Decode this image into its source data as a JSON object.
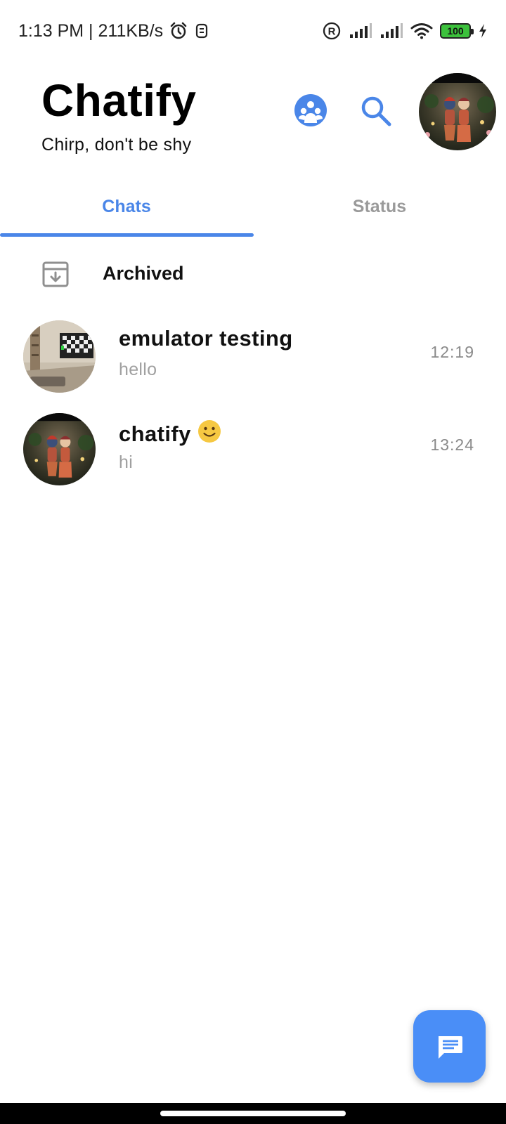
{
  "status_bar": {
    "time_speed": "1:13 PM | 211KB/s",
    "battery": "100",
    "icons": [
      "alarm-icon",
      "notification-icon",
      "registered-icon",
      "signal-icon",
      "signal-icon",
      "wifi-icon",
      "battery-icon",
      "charging-icon"
    ]
  },
  "header": {
    "title": "Chatify",
    "subtitle": "Chirp, don't be shy",
    "icons": [
      "groups-icon",
      "search-icon",
      "profile-avatar"
    ]
  },
  "tabs": [
    {
      "label": "Chats",
      "active": true
    },
    {
      "label": "Status",
      "active": false
    }
  ],
  "archived": {
    "label": "Archived",
    "icon": "archive-icon"
  },
  "chats": [
    {
      "name": "emulator testing",
      "preview": "hello",
      "time": "12:19",
      "avatar": "room-photo"
    },
    {
      "name": "chatify",
      "emoji": "slightly-smiling-face",
      "preview": "hi",
      "time": "13:24",
      "avatar": "figurines-photo"
    }
  ],
  "fab": {
    "icon": "chat-icon"
  },
  "colors": {
    "accent": "#4a86e8",
    "fab": "#4a8ef7",
    "inactive_tab": "#9a9a9a",
    "preview_text": "#a0a0a0"
  }
}
